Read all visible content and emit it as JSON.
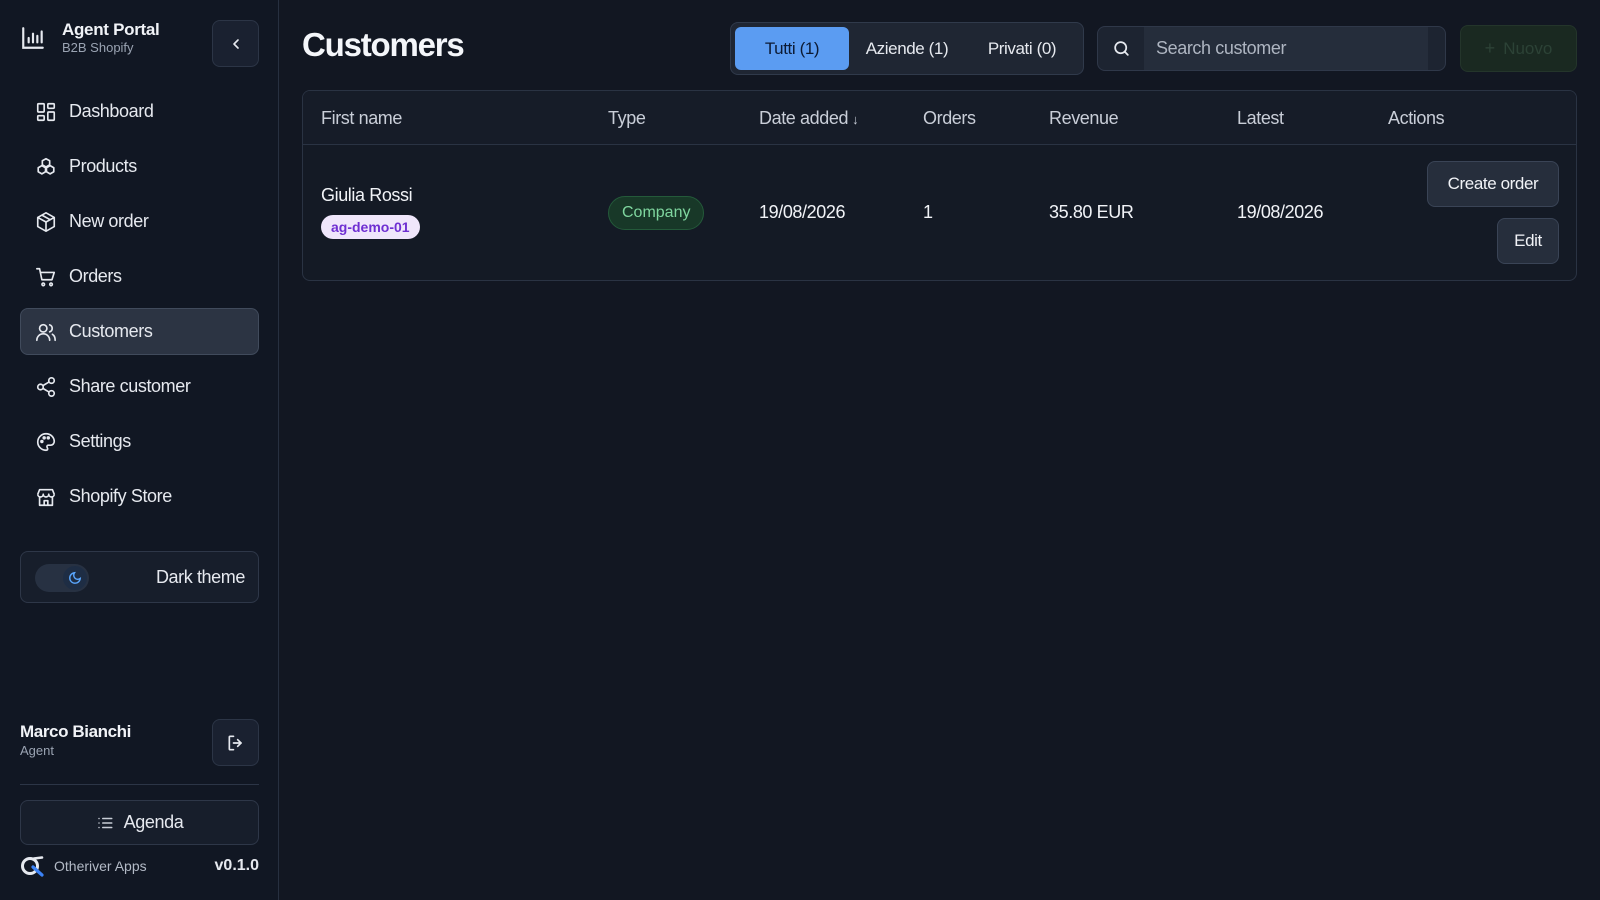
{
  "sidebar": {
    "brand": {
      "title": "Agent Portal",
      "subtitle": "B2B Shopify"
    },
    "items": [
      {
        "label": "Dashboard",
        "icon": "dashboard-icon"
      },
      {
        "label": "Products",
        "icon": "products-icon"
      },
      {
        "label": "New order",
        "icon": "package-icon"
      },
      {
        "label": "Orders",
        "icon": "cart-icon"
      },
      {
        "label": "Customers",
        "icon": "users-icon",
        "active": true
      },
      {
        "label": "Share customer",
        "icon": "share-icon"
      },
      {
        "label": "Settings",
        "icon": "palette-icon"
      },
      {
        "label": "Shopify Store",
        "icon": "store-icon"
      }
    ],
    "theme_label": "Dark theme",
    "user": {
      "name": "Marco Bianchi",
      "role": "Agent"
    },
    "agenda_label": "Agenda",
    "footer": {
      "company": "Otheriver Apps",
      "version": "v0.1.0"
    }
  },
  "main": {
    "title": "Customers",
    "filters": [
      "Tutti (1)",
      "Aziende (1)",
      "Privati (0)"
    ],
    "active_filter": "Tutti (1)",
    "search": {
      "placeholder": "Search customer"
    },
    "new_button_label": "Nuovo",
    "table": {
      "columns": [
        "First name",
        "Type",
        "Date added",
        "Orders",
        "Revenue",
        "Latest",
        "Actions"
      ],
      "sort_indicator": "↓",
      "rows": [
        {
          "name": "Giulia Rossi",
          "tag": "ag-demo-01",
          "type": "Company",
          "date_added": "19/08/2026",
          "orders": "1",
          "revenue": "35.80 EUR",
          "latest": "19/08/2026",
          "actions": [
            "Create order",
            "Edit"
          ]
        }
      ]
    }
  },
  "colors": {
    "background": "#121722",
    "sidebar": "#111723",
    "accent": "#5b9cf2",
    "company_badge": "#7fd69f",
    "tag": "#6f2fd2"
  }
}
